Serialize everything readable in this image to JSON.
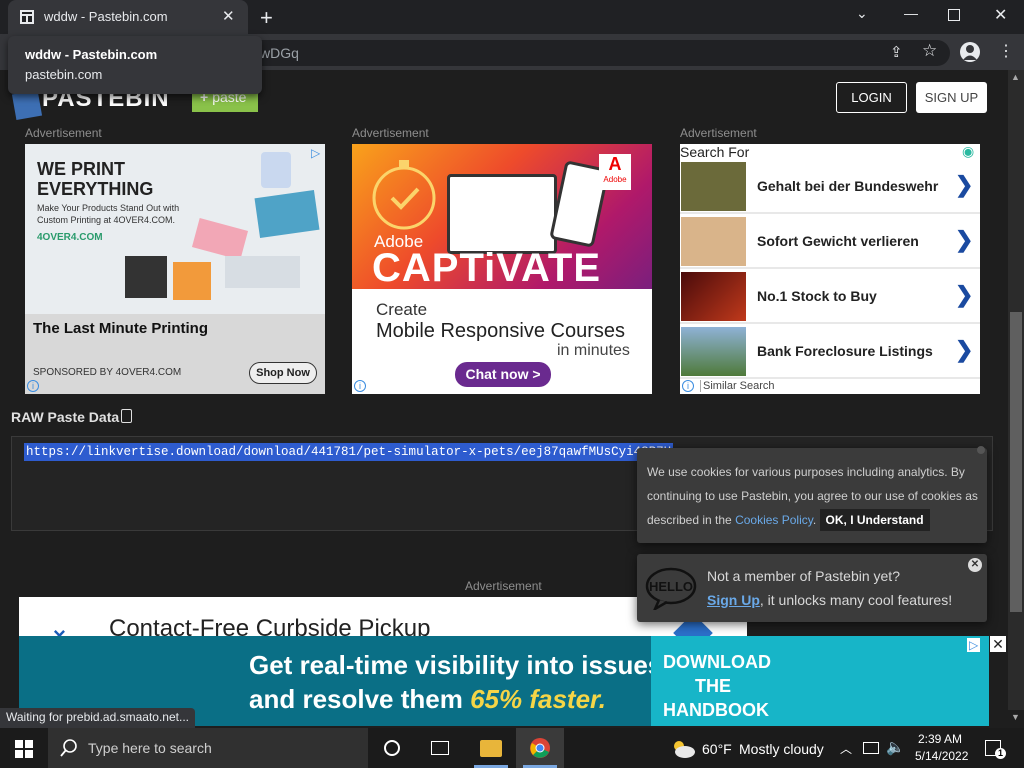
{
  "browser": {
    "tab_title": "wddw - Pastebin.com",
    "tab_close": "✕",
    "new_tab": "+",
    "omnibox_partial": "wDGq",
    "tooltip_title": "wddw - Pastebin.com",
    "tooltip_url": "pastebin.com",
    "status": "Waiting for prebid.ad.smaato.net..."
  },
  "header": {
    "logo": "PASTEBIN",
    "paste_label": "paste",
    "login_label": "LOGIN",
    "signup_label": "SIGN UP"
  },
  "ads": {
    "label": "Advertisement",
    "ad1": {
      "headline1": "WE PRINT",
      "headline2": "EVERYTHING",
      "sub1": "Make Your Products Stand Out with",
      "sub2": "Custom Printing at 4OVER4.COM.",
      "brand": "4OVER4.COM",
      "title": "The Last Minute Printing",
      "sponsor": "SPONSORED BY 4OVER4.COM",
      "cta": "Shop Now"
    },
    "ad2": {
      "brand": "Adobe",
      "product_small": "Adobe",
      "product_big": "CAPTiVATE",
      "line1": "Create",
      "line2": "Mobile Responsive Courses",
      "line3": "in minutes",
      "cta": "Chat now >"
    },
    "ad3": {
      "header": "Search For",
      "rows": [
        "Gehalt bei der Bundeswehr",
        "Sofort Gewicht verlieren",
        "No.1 Stock to Buy",
        "Bank Foreclosure Listings"
      ],
      "footer": "Similar Search"
    },
    "lower_text": "Contact-Free Curbside Pickup",
    "banner": {
      "line1": "Get real-time visibility into issues",
      "line2a": "and resolve them ",
      "line2b": "65% faster.",
      "cta1": "DOWNLOAD",
      "cta2": "THE",
      "cta3": "HANDBOOK"
    }
  },
  "raw": {
    "title": "RAW Paste Data",
    "text": "https://linkvertise.download/download/441781/pet-simulator-x-pets/eej87qawfMUsCyi4SR7H"
  },
  "cookie": {
    "text1": "We use cookies for various purposes including analytics. By continuing to use Pastebin, you agree to our use of cookies as described in the ",
    "link": "Cookies Policy",
    "text2": ". ",
    "ok": "OK, I Understand"
  },
  "hello": {
    "badge": "HELLO",
    "line1": "Not a member of Pastebin yet?",
    "signup": "Sign Up",
    "line2": ", it unlocks many cool features!"
  },
  "taskbar": {
    "search_placeholder": "Type here to search",
    "weather_temp": "60°F",
    "weather_desc": "Mostly cloudy",
    "time": "2:39 AM",
    "date": "5/14/2022",
    "notif_count": "1"
  },
  "colors": {
    "paste_green": "#8ac24a",
    "banner_teal": "#0a6f86",
    "selection_blue": "#2e5ccf"
  }
}
